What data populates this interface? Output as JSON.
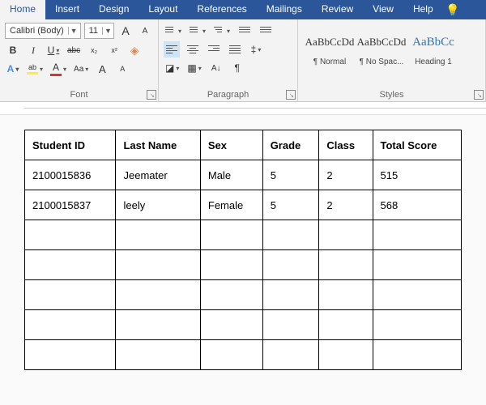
{
  "tabs": {
    "items": [
      "Home",
      "Insert",
      "Design",
      "Layout",
      "References",
      "Mailings",
      "Review",
      "View",
      "Help"
    ],
    "active": 0
  },
  "font": {
    "name": "Calibri (Body)",
    "size": "11",
    "increase": "A",
    "decrease": "A",
    "bold": "B",
    "italic": "I",
    "underline": "U",
    "strike": "abc",
    "sub": "x₂",
    "sup": "x²",
    "clear": "⌫",
    "effects": "A",
    "highlight": "ab",
    "color": "A",
    "case": "Aa",
    "bigA": "A",
    "smA": "A",
    "label": "Font"
  },
  "para": {
    "label": "Paragraph",
    "shading": "◧",
    "borders": "▦",
    "sort": "A↓",
    "marks": "¶"
  },
  "styles": {
    "label": "Styles",
    "items": [
      {
        "preview": "AaBbCcDd",
        "name": "¶ Normal"
      },
      {
        "preview": "AaBbCcDd",
        "name": "¶ No Spac..."
      },
      {
        "preview": "AaBbCc",
        "name": "Heading 1",
        "h1": true
      }
    ]
  },
  "table": {
    "headers": [
      "Student ID",
      "Last Name",
      "Sex",
      "Grade",
      "Class",
      "Total Score"
    ],
    "rows": [
      [
        "2100015836",
        "Jeemater",
        "Male",
        "5",
        "2",
        "515"
      ],
      [
        "2100015837",
        "leely",
        "Female",
        "5",
        "2",
        "568"
      ],
      [
        "",
        "",
        "",
        "",
        "",
        ""
      ],
      [
        "",
        "",
        "",
        "",
        "",
        ""
      ],
      [
        "",
        "",
        "",
        "",
        "",
        ""
      ],
      [
        "",
        "",
        "",
        "",
        "",
        ""
      ],
      [
        "",
        "",
        "",
        "",
        "",
        ""
      ]
    ]
  }
}
